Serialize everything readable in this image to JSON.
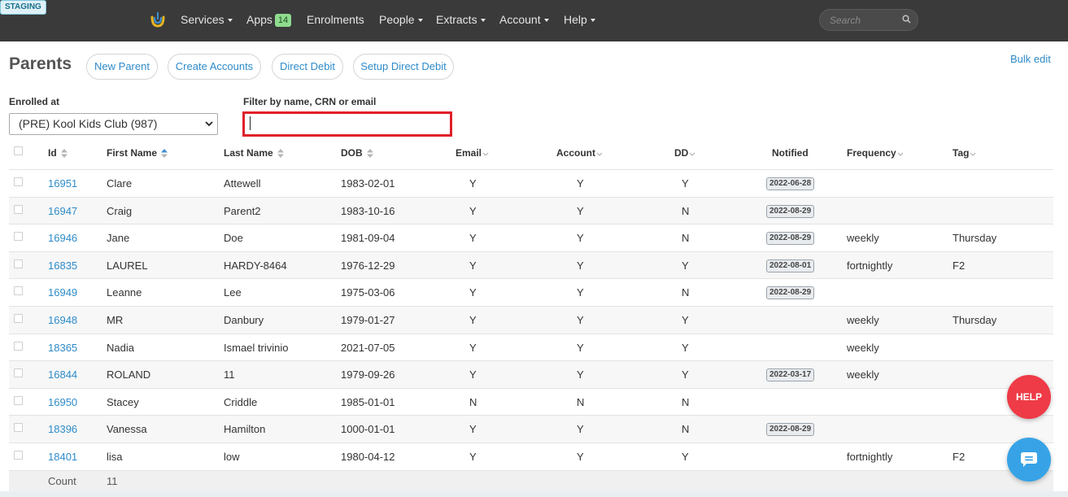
{
  "env_badge": "STAGING",
  "nav": {
    "items": [
      {
        "label": "Services",
        "dropdown": true
      },
      {
        "label": "Apps",
        "badge": "14",
        "dropdown": false
      },
      {
        "label": "Enrolments",
        "dropdown": false
      },
      {
        "label": "People",
        "dropdown": true
      },
      {
        "label": "Extracts",
        "dropdown": true
      },
      {
        "label": "Account",
        "dropdown": true
      },
      {
        "label": "Help",
        "dropdown": true
      }
    ],
    "search_placeholder": "Search"
  },
  "header": {
    "title": "Parents",
    "buttons": [
      "New Parent",
      "Create Accounts",
      "Direct Debit",
      "Setup Direct Debit"
    ],
    "bulk_edit": "Bulk edit"
  },
  "filters": {
    "enrolled_label": "Enrolled at",
    "enrolled_value": "(PRE) Kool Kids Club (987)",
    "filter_label": "Filter by name, CRN or email",
    "filter_value": ""
  },
  "table": {
    "columns": [
      "Id",
      "First Name",
      "Last Name",
      "DOB",
      "Email",
      "Account",
      "DD",
      "Notified",
      "Frequency",
      "Tag"
    ],
    "rows": [
      {
        "id": "16951",
        "first": "Clare",
        "last": "Attewell",
        "dob": "1983-02-01",
        "email": "Y",
        "account": "Y",
        "dd": "Y",
        "notified": "2022-06-28",
        "frequency": "",
        "tag": ""
      },
      {
        "id": "16947",
        "first": "Craig",
        "last": "Parent2",
        "dob": "1983-10-16",
        "email": "Y",
        "account": "Y",
        "dd": "N",
        "notified": "2022-08-29",
        "frequency": "",
        "tag": ""
      },
      {
        "id": "16946",
        "first": "Jane",
        "last": "Doe",
        "dob": "1981-09-04",
        "email": "Y",
        "account": "Y",
        "dd": "N",
        "notified": "2022-08-29",
        "frequency": "weekly",
        "tag": "Thursday"
      },
      {
        "id": "16835",
        "first": "LAUREL",
        "last": "HARDY-8464",
        "dob": "1976-12-29",
        "email": "Y",
        "account": "Y",
        "dd": "Y",
        "notified": "2022-08-01",
        "frequency": "fortnightly",
        "tag": "F2"
      },
      {
        "id": "16949",
        "first": "Leanne",
        "last": "Lee",
        "dob": "1975-03-06",
        "email": "Y",
        "account": "Y",
        "dd": "N",
        "notified": "2022-08-29",
        "frequency": "",
        "tag": ""
      },
      {
        "id": "16948",
        "first": "MR",
        "last": "Danbury",
        "dob": "1979-01-27",
        "email": "Y",
        "account": "Y",
        "dd": "Y",
        "notified": "",
        "frequency": "weekly",
        "tag": "Thursday"
      },
      {
        "id": "18365",
        "first": "Nadia",
        "last": "Ismael trivinio",
        "dob": "2021-07-05",
        "email": "Y",
        "account": "Y",
        "dd": "Y",
        "notified": "",
        "frequency": "weekly",
        "tag": ""
      },
      {
        "id": "16844",
        "first": "ROLAND",
        "last": "11",
        "dob": "1979-09-26",
        "email": "Y",
        "account": "Y",
        "dd": "Y",
        "notified": "2022-03-17",
        "frequency": "weekly",
        "tag": ""
      },
      {
        "id": "16950",
        "first": "Stacey",
        "last": "Criddle",
        "dob": "1985-01-01",
        "email": "N",
        "account": "N",
        "dd": "N",
        "notified": "",
        "frequency": "",
        "tag": ""
      },
      {
        "id": "18396",
        "first": "Vanessa",
        "last": "Hamilton",
        "dob": "1000-01-01",
        "email": "Y",
        "account": "Y",
        "dd": "N",
        "notified": "2022-08-29",
        "frequency": "",
        "tag": ""
      },
      {
        "id": "18401",
        "first": "lisa",
        "last": "low",
        "dob": "1980-04-12",
        "email": "Y",
        "account": "Y",
        "dd": "Y",
        "notified": "",
        "frequency": "fortnightly",
        "tag": "F2"
      }
    ],
    "footer": {
      "label": "Count",
      "value": "11"
    }
  },
  "help_button": "HELP",
  "colors": {
    "accent": "#2e8bc9",
    "navbar": "#3a3a3a",
    "help": "#ee3b47",
    "chat": "#37a3e6",
    "highlight": "#e0202a"
  }
}
